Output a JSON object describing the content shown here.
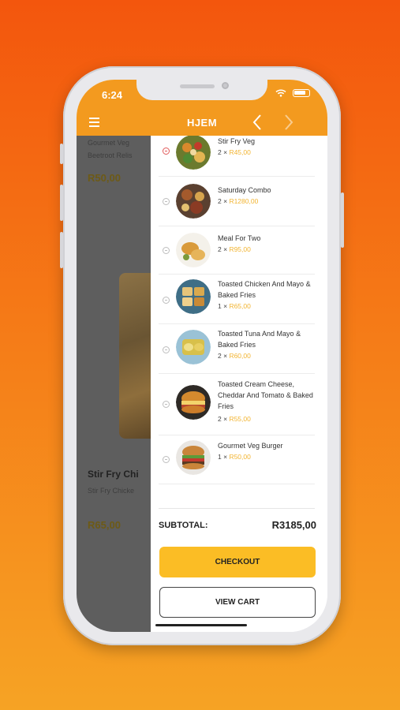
{
  "status_bar": {
    "time": "6:24"
  },
  "header": {
    "title": "HJEM",
    "back_icon": "chevron-left-icon",
    "forward_icon": "chevron-right-icon",
    "menu_icon": "hamburger-icon"
  },
  "background_page": {
    "item1_desc_line1": "Gourmet Veg",
    "item1_desc_line2": "Beetroot Relis",
    "item1_price": "R50,00",
    "item2_title": "Stir Fry Chi",
    "item2_desc": "Stir Fry Chicke",
    "item2_price": "R65,00"
  },
  "cart": {
    "items": [
      {
        "name": "Stir Fry Veg",
        "qty": "2 ×",
        "price": "R45,00"
      },
      {
        "name": "Saturday Combo",
        "qty": "2 ×",
        "price": "R1280,00"
      },
      {
        "name": "Meal For Two",
        "qty": "2 ×",
        "price": "R95,00"
      },
      {
        "name": "Toasted Chicken And Mayo & Baked Fries",
        "qty": "1 ×",
        "price": "R65,00"
      },
      {
        "name": "Toasted Tuna And Mayo & Baked Fries",
        "qty": "2 ×",
        "price": "R60,00"
      },
      {
        "name": "Toasted Cream Cheese, Cheddar And Tomato & Baked Fries",
        "qty": "2 ×",
        "price": "R55,00"
      },
      {
        "name": "Gourmet Veg Burger",
        "qty": "1 ×",
        "price": "R50,00"
      }
    ],
    "subtotal_label": "SUBTOTAL:",
    "subtotal_value": "R3185,00",
    "checkout_label": "CHECKOUT",
    "view_cart_label": "VIEW CART"
  },
  "colors": {
    "brand_orange": "#f39a1f",
    "checkout_yellow": "#fbbd25",
    "price_yellow": "#f2b431",
    "whatsapp_green": "#25c251"
  }
}
